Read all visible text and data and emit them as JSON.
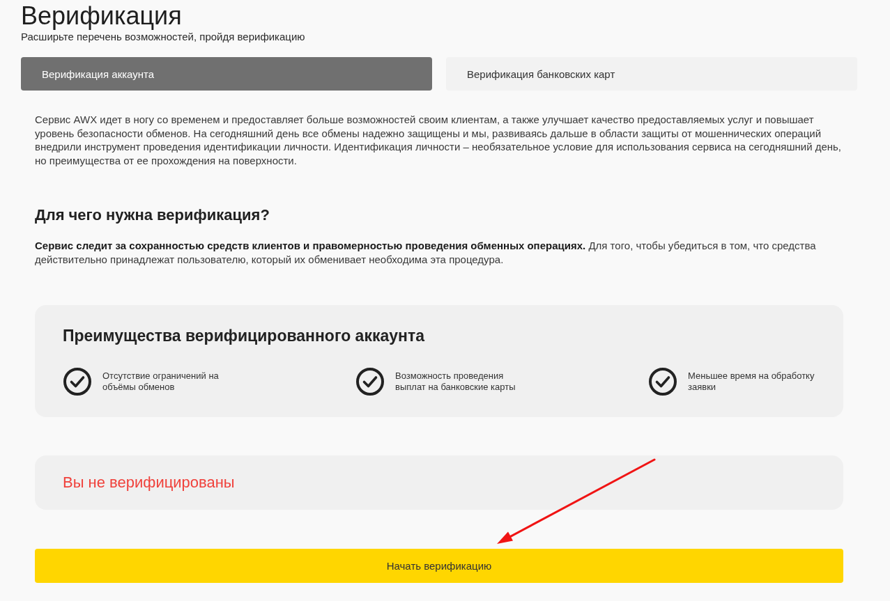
{
  "page": {
    "title": "Верификация",
    "subtitle": "Расширьте перечень возможностей, пройдя верификацию"
  },
  "tabs": [
    {
      "label": "Верификация аккаунта",
      "selected": true
    },
    {
      "label": "Верификация банковских карт",
      "selected": false
    }
  ],
  "intro": "Сервис AWX идет в ногу со временем и предоставляет больше возможностей своим клиентам, а также улучшает качество предоставляемых услуг и повышает уровень безопасности обменов. На сегодняшний день все обмены надежно защищены и мы, развиваясь дальше в области защиты от мошеннических операций внедрили инструмент проведения идентификации личности. Идентификация личности – необязательное условие для использования сервиса на сегодняшний день, но преимущества от ее прохождения на поверхности.",
  "why": {
    "heading": "Для чего нужна верификация?",
    "text": "**Сервис следит за сохранностью средств клиентов и правомерностью проведения обменных операциях.** Для того, чтобы убедиться в том, что средства действительно принадлежат пользователю, который их обменивает необходима эта процедура."
  },
  "benefits": {
    "title": "Преимущества верифицированного аккаунта",
    "items": [
      {
        "text": "Отсутствие ограничений на объёмы обменов"
      },
      {
        "text": "Возможность проведения выплат на банковские карты"
      },
      {
        "text": "Меньшее время на обработку заявки"
      }
    ]
  },
  "status": {
    "text": "Вы не верифицированы",
    "verified": false
  },
  "start_button": {
    "label": "Начать верификацию"
  }
}
